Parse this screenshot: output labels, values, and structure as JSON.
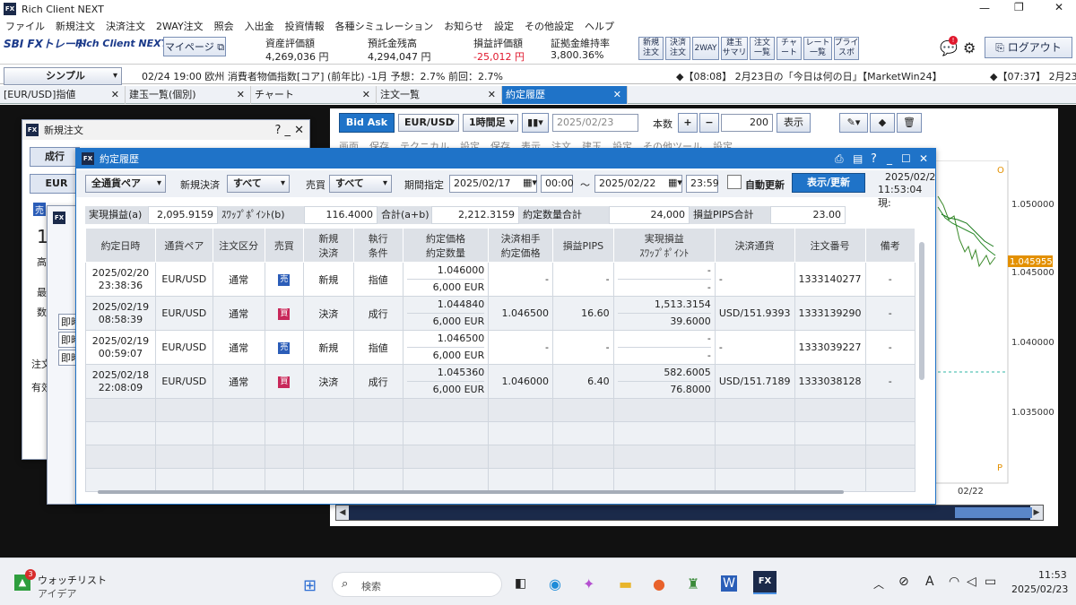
{
  "window": {
    "title": "Rich Client NEXT",
    "controls": [
      "—",
      "❐",
      "✕"
    ]
  },
  "menu": [
    "ファイル",
    "新規注文",
    "決済注文",
    "2WAY注文",
    "照会",
    "入出金",
    "投資情報",
    "各種シミュレーション",
    "お知らせ",
    "設定",
    "その他設定",
    "ヘルプ"
  ],
  "brand": {
    "sbi": "SBI FXトレード",
    "app": "Rich Client NEXT",
    "mypage": "マイページ"
  },
  "account": [
    {
      "label": "資産評価額",
      "value": "4,269,036 円",
      "negative": false
    },
    {
      "label": "預託金残高",
      "value": "4,294,047 円",
      "negative": false
    },
    {
      "label": "損益評価額",
      "value": "-25,012 円",
      "negative": true
    },
    {
      "label": "証拠金維持率",
      "value": "3,800.36%",
      "negative": false
    }
  ],
  "quick_buttons": [
    "新規\n注文",
    "決済\n注文",
    "2WAY",
    "建玉\nサマリ",
    "注文\n一覧",
    "チャ\nート",
    "レート\n一覧",
    "プライ\nスボ"
  ],
  "logout": "ログアウト",
  "ticker": {
    "mode": "シンプル",
    "text1": "02/24 19:00 欧州 消費者物価指数[コア] (前年比) -1月 予想：2.7% 前回：2.7%",
    "text2": "◆【08:08】 2月23日の「今日は何の日」【MarketWin24】",
    "text3": "◆【07:37】 2月23日"
  },
  "tabs": [
    {
      "label": "[EUR/USD]指値"
    },
    {
      "label": "建玉一覧(個別)"
    },
    {
      "label": "チャート"
    },
    {
      "label": "注文一覧"
    },
    {
      "label": "約定履歴"
    }
  ],
  "new_order": {
    "title": "新規注文",
    "controls": "? _ ✕",
    "type": "成行",
    "pair": "EUR",
    "side": "売",
    "lot": "1",
    "labels": [
      "高",
      "最",
      "数",
      "注文",
      "有効"
    ],
    "instant": [
      "即時",
      "即時",
      "即時"
    ]
  },
  "chart_panel": {
    "bid_ask": "Bid Ask",
    "pair": "EUR/USD",
    "interval": "1時間足",
    "date": "2025/02/23",
    "qty_label": "本数",
    "qty": "200",
    "show": "表示",
    "row2": [
      "画面",
      "保存",
      "テクニカル",
      "設定",
      "保存",
      "表示",
      "注文",
      "建玉",
      "設定",
      "その他ツール",
      "設定"
    ],
    "prices": [
      "1.050000",
      "1.045000",
      "1.040000",
      "1.035000"
    ],
    "current_price": "1.045955",
    "date_label": "02/22",
    "markers": [
      "O",
      "P"
    ]
  },
  "history": {
    "title": "約定履歴",
    "filters": {
      "pair": "全通貨ペア",
      "new_settle_label": "新規決済",
      "new_settle": "すべて",
      "side_label": "売買",
      "side": "すべて",
      "period_label": "期間指定",
      "from_date": "2025/02/17",
      "from_time": "00:00",
      "tilde": "～",
      "to_date": "2025/02/22",
      "to_time": "23:59",
      "auto_label": "自動更新",
      "refresh": "表示/更新",
      "timestamp_date": "2025/02/2",
      "timestamp_time": "11:53:04現:"
    },
    "summary": [
      {
        "label": "実現損益(a)",
        "value": "2,095.9159"
      },
      {
        "label": "ｽﾜｯﾌﾟﾎﾟｲﾝﾄ(b)",
        "value": "116.4000"
      },
      {
        "label": "合計(a+b)",
        "value": "2,212.3159"
      },
      {
        "label": "約定数量合計",
        "value": "24,000"
      },
      {
        "label": "損益PIPS合計",
        "value": "23.00"
      }
    ],
    "headers": [
      "約定日時",
      "通貨ペア",
      "注文区分",
      "売買",
      "新規\n決済",
      "執行\n条件",
      "約定価格\n約定数量",
      "決済相手\n約定価格",
      "損益PIPS",
      "実現損益\nｽﾜｯﾌﾟﾎﾟｲﾝﾄ",
      "決済通貨",
      "注文番号",
      "備考"
    ],
    "rows": [
      {
        "date": "2025/02/20",
        "time": "23:38:36",
        "pair": "EUR/USD",
        "kind": "通常",
        "side": "売",
        "side_color": "#2b5db8",
        "new_settle": "新規",
        "cond": "指値",
        "price": "1.046000",
        "qty": "6,000 EUR",
        "settle_price": "-",
        "pips": "-",
        "pnl": "-",
        "swap": "-",
        "settle_ccy": "-",
        "order_no": "1333140277",
        "note": "-"
      },
      {
        "date": "2025/02/19",
        "time": "08:58:39",
        "pair": "EUR/USD",
        "kind": "通常",
        "side": "買",
        "side_color": "#c8285a",
        "new_settle": "決済",
        "cond": "成行",
        "price": "1.044840",
        "qty": "6,000 EUR",
        "settle_price": "1.046500",
        "pips": "16.60",
        "pnl": "1,513.3154",
        "swap": "39.6000",
        "settle_ccy": "USD/151.9393",
        "order_no": "1333139290",
        "note": "-"
      },
      {
        "date": "2025/02/19",
        "time": "00:59:07",
        "pair": "EUR/USD",
        "kind": "通常",
        "side": "売",
        "side_color": "#2b5db8",
        "new_settle": "新規",
        "cond": "指値",
        "price": "1.046500",
        "qty": "6,000 EUR",
        "settle_price": "-",
        "pips": "-",
        "pnl": "-",
        "swap": "-",
        "settle_ccy": "-",
        "order_no": "1333039227",
        "note": "-"
      },
      {
        "date": "2025/02/18",
        "time": "22:08:09",
        "pair": "EUR/USD",
        "kind": "通常",
        "side": "買",
        "side_color": "#c8285a",
        "new_settle": "決済",
        "cond": "成行",
        "price": "1.045360",
        "qty": "6,000 EUR",
        "settle_price": "1.046000",
        "pips": "6.40",
        "pnl": "582.6005",
        "swap": "76.8000",
        "settle_ccy": "USD/151.7189",
        "order_no": "1333038128",
        "note": "-"
      }
    ]
  },
  "taskbar": {
    "watch_badge": "3",
    "watch_title": "ウォッチリスト",
    "watch_sub": "アイデア",
    "search": "検索",
    "time": "11:53",
    "date": "2025/02/23",
    "ime": "A"
  },
  "colors": {
    "accent": "#1f73c8",
    "negative": "#e0182d",
    "sell": "#2b5db8",
    "buy": "#c8285a"
  }
}
